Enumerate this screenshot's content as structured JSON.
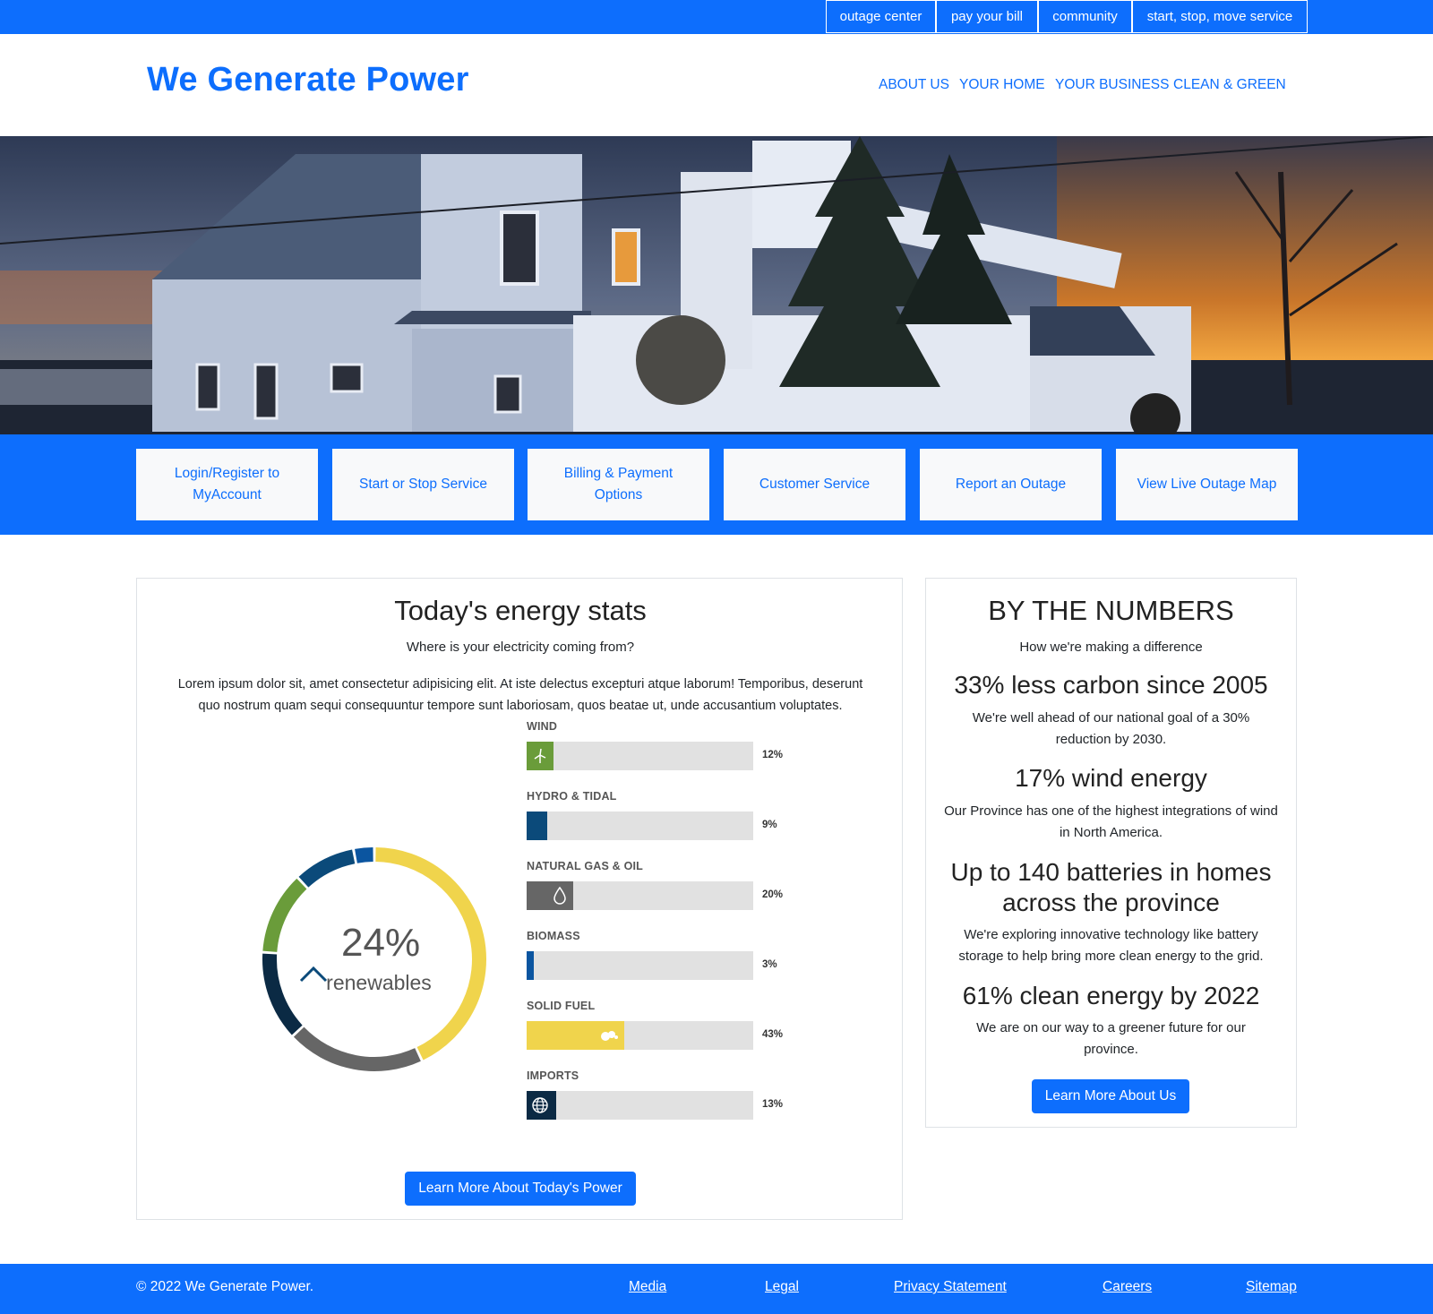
{
  "utility_nav": [
    "outage center",
    "pay your bill",
    "community",
    "start, stop, move service"
  ],
  "brand": "We Generate Power",
  "main_nav": [
    "ABOUT US",
    "YOUR HOME",
    "YOUR BUSINESS",
    "CLEAN & GREEN"
  ],
  "quick_links": [
    "Login/Register to MyAccount",
    "Start or Stop Service",
    "Billing & Payment Options",
    "Customer Service",
    "Report an Outage",
    "View Live Outage Map"
  ],
  "energy_stats": {
    "title": "Today's energy stats",
    "subtitle": "Where is your electricity coming from?",
    "body": "Lorem ipsum dolor sit, amet consectetur adipisicing elit. At iste delectus excepturi atque laborum! Temporibus, deserunt quo nostrum quam sequi consequuntur tempore sunt laboriosam, quos beatae ut, unde accusantium voluptates.",
    "donut_value": "24%",
    "donut_label": "renewables",
    "button": "Learn More About Today's Power"
  },
  "chart_data": {
    "type": "bar",
    "categories": [
      "WIND",
      "HYDRO & TIDAL",
      "NATURAL GAS & OIL",
      "BIOMASS",
      "SOLID FUEL",
      "IMPORTS"
    ],
    "values": [
      12,
      9,
      20,
      3,
      43,
      13
    ],
    "value_labels": [
      "12%",
      "9%",
      "20%",
      "3%",
      "43%",
      "13%"
    ],
    "colors": [
      "#6a9c3a",
      "#0b4a7a",
      "#666666",
      "#0b55a0",
      "#f0d44c",
      "#0b2a44"
    ],
    "icons": [
      "wind-turbine-icon",
      "",
      "droplet-icon",
      "",
      "coal-icon",
      "globe-icon"
    ],
    "ylim": [
      0,
      100
    ]
  },
  "numbers": {
    "title": "BY THE NUMBERS",
    "subtitle": "How we're making a difference",
    "items": [
      {
        "heading": "33% less carbon since 2005",
        "text": "We're well ahead of our national goal of a 30% reduction by 2030."
      },
      {
        "heading": "17% wind energy",
        "text": "Our Province has one of the highest integrations of wind in North America."
      },
      {
        "heading": "Up to 140 batteries in homes across the province",
        "text": "We're exploring innovative technology like battery storage to help bring more clean energy to the grid."
      },
      {
        "heading": "61% clean energy by 2022",
        "text": "We are on our way to a greener future for our province."
      }
    ],
    "button": "Learn More About Us"
  },
  "footer": {
    "copyright": "© 2022 We Generate Power.",
    "links": [
      "Media",
      "Legal",
      "Privacy Statement",
      "Careers",
      "Sitemap"
    ]
  }
}
